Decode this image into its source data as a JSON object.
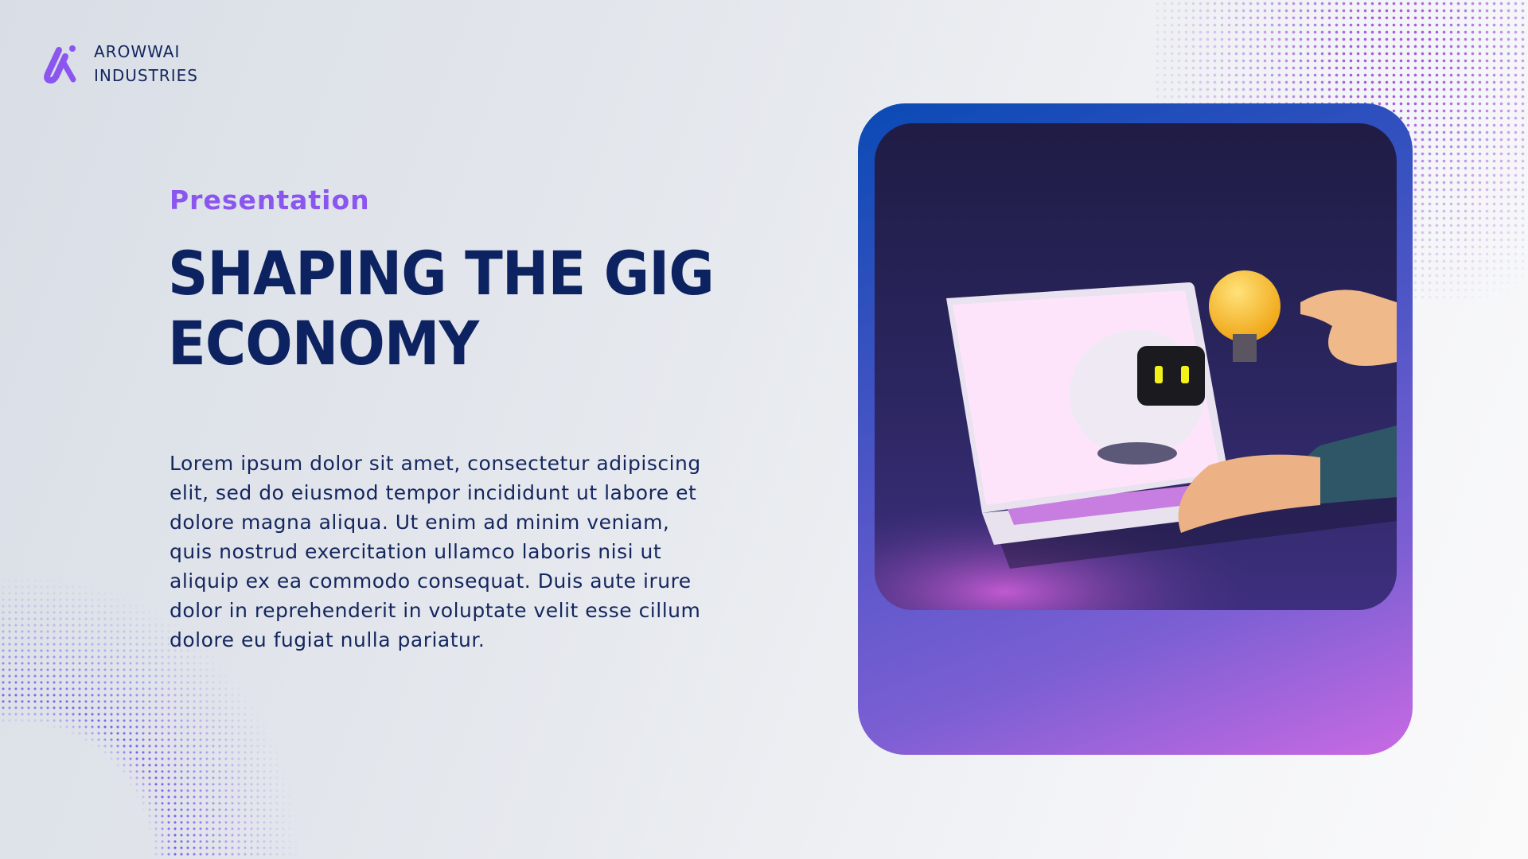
{
  "brand": {
    "line1": "AROWWAI",
    "line2": "INDUSTRIES",
    "accent": "#8b55f0"
  },
  "hero": {
    "eyebrow": "Presentation",
    "title": "SHAPING THE GIG ECONOMY",
    "body": "Lorem ipsum dolor sit amet, consectetur adipiscing elit, sed do eiusmod tempor incididunt ut labore et dolore magna aliqua. Ut enim ad minim veniam, quis nostrud exercitation ullamco laboris nisi ut aliquip ex ea commodo consequat. Duis aute irure dolor in reprehenderit in voluptate velit esse cillum dolore eu fugiat nulla pariatur."
  },
  "colors": {
    "title": "#0d2260",
    "card_start": "#0a4ab5",
    "card_end": "#c86ae3"
  }
}
